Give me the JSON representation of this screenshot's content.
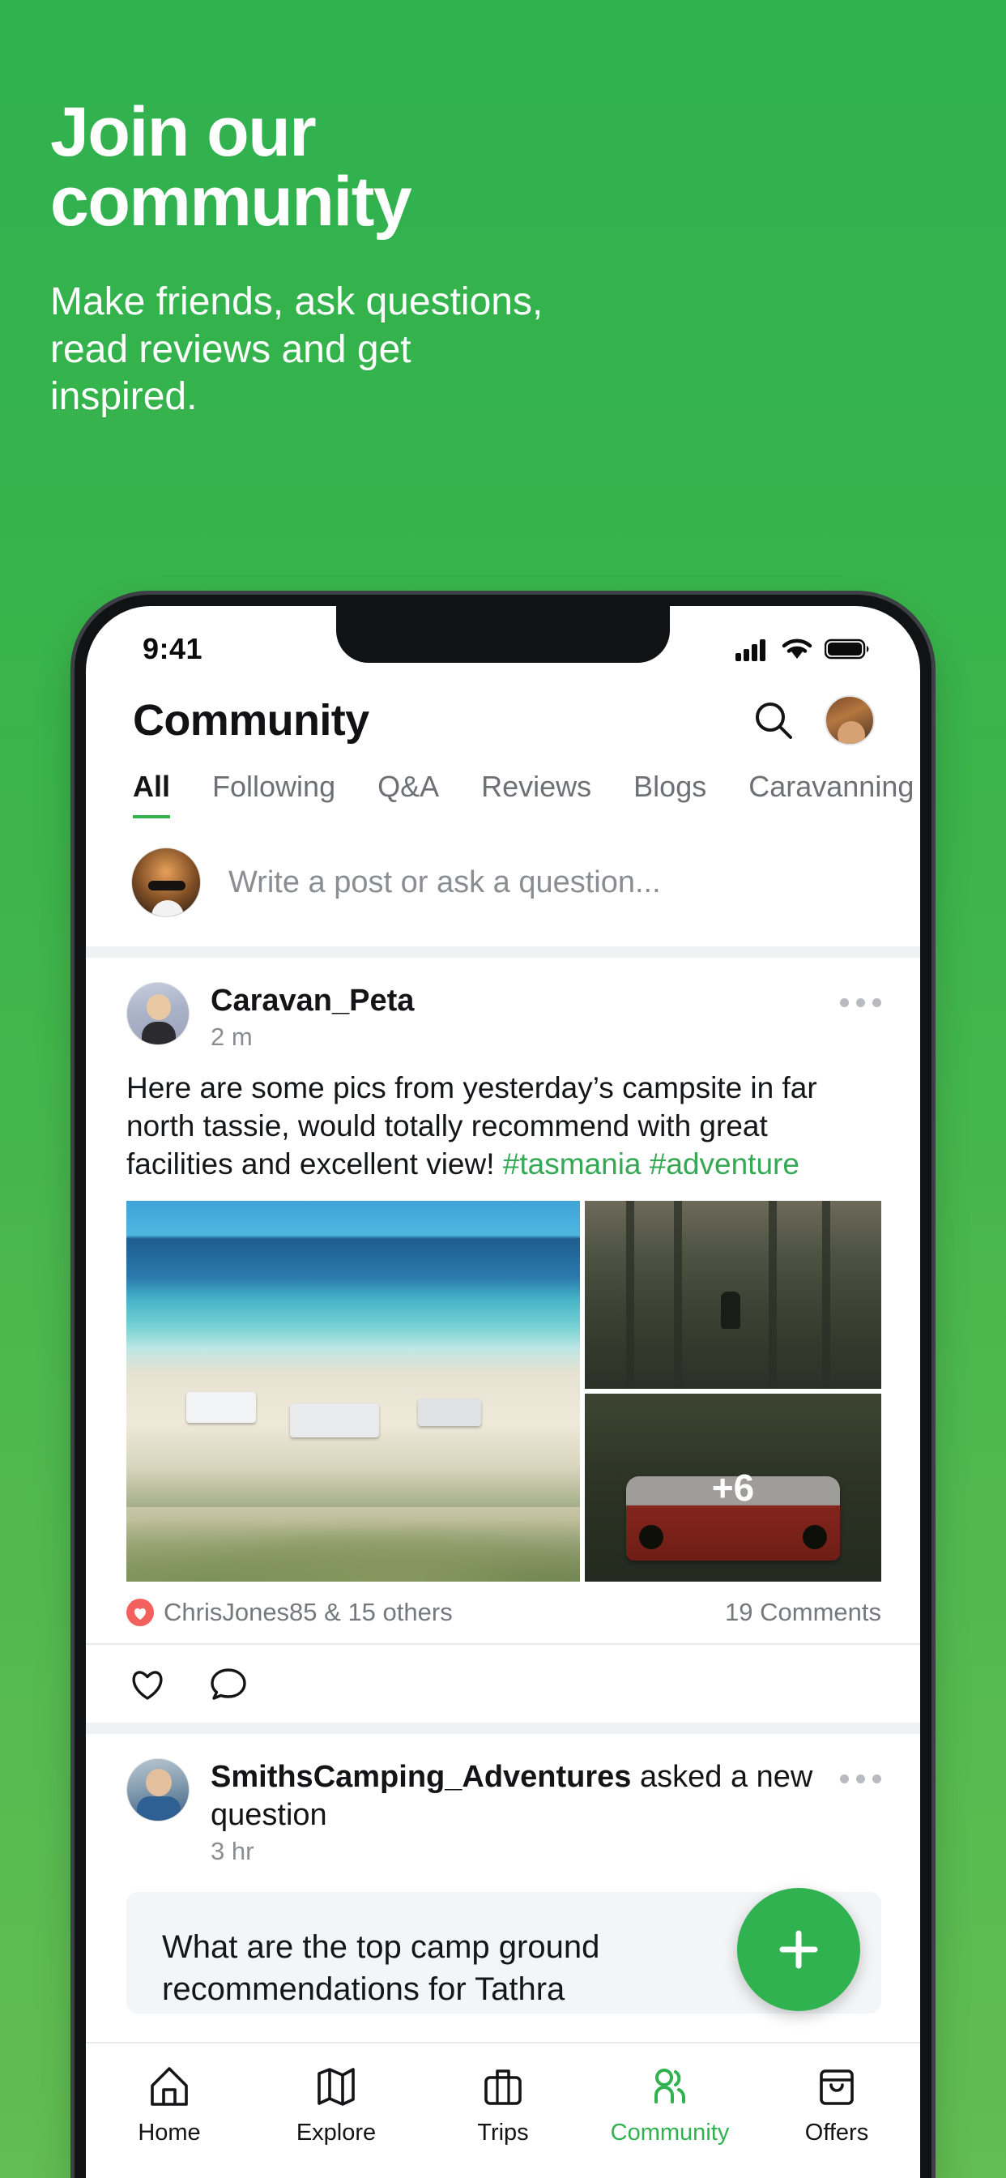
{
  "promo": {
    "title_line1": "Join our",
    "title_line2": "community",
    "subtitle_line1": "Make friends, ask questions,",
    "subtitle_line2": "read reviews and get inspired."
  },
  "colors": {
    "brand_green": "#2fb24f",
    "background_green": "#3cb44a",
    "hashtag_green": "#34a853",
    "like_red": "#f2615d",
    "text_primary": "#141416",
    "text_secondary": "#8b8d92"
  },
  "status_bar": {
    "time": "9:41",
    "signal_icon": "cellular-signal-icon",
    "wifi_icon": "wifi-icon",
    "battery_icon": "battery-icon"
  },
  "app_header": {
    "title": "Community",
    "search_icon": "search-icon",
    "avatar": "profile-avatar"
  },
  "tabs": [
    {
      "label": "All",
      "active": true
    },
    {
      "label": "Following",
      "active": false
    },
    {
      "label": "Q&A",
      "active": false
    },
    {
      "label": "Reviews",
      "active": false
    },
    {
      "label": "Blogs",
      "active": false
    },
    {
      "label": "Caravanning",
      "active": false
    }
  ],
  "composer": {
    "placeholder": "Write a post or ask a question...",
    "avatar": "current-user-avatar"
  },
  "posts": [
    {
      "user": "Caravan_Peta",
      "suffix": "",
      "time": "2 m",
      "body_text": "Here are some pics from yesterday’s campsite in far north tassie, would totally recommend with great facilities and excellent view! ",
      "hashtags": "#tasmania #adventure",
      "more_icon": "more-options-icon",
      "photos_overflow": "+6",
      "likes_text": "ChrisJones85 & 15 others",
      "comments_text": "19 Comments",
      "like_icon": "heart-icon",
      "comment_icon": "comment-icon",
      "like_badge_icon": "heart-filled-badge-icon"
    },
    {
      "user": "SmithsCamping_Adventures",
      "suffix": " asked a new question",
      "time": "3 hr",
      "question": "What are the top camp ground recommendations for Tathra",
      "more_icon": "more-options-icon"
    }
  ],
  "fab": {
    "icon": "plus-icon",
    "label": "Create post"
  },
  "bottom_nav": [
    {
      "label": "Home",
      "icon": "home-icon",
      "active": false
    },
    {
      "label": "Explore",
      "icon": "map-icon",
      "active": false
    },
    {
      "label": "Trips",
      "icon": "suitcase-icon",
      "active": false
    },
    {
      "label": "Community",
      "icon": "people-icon",
      "active": true
    },
    {
      "label": "Offers",
      "icon": "bag-icon",
      "active": false
    }
  ]
}
